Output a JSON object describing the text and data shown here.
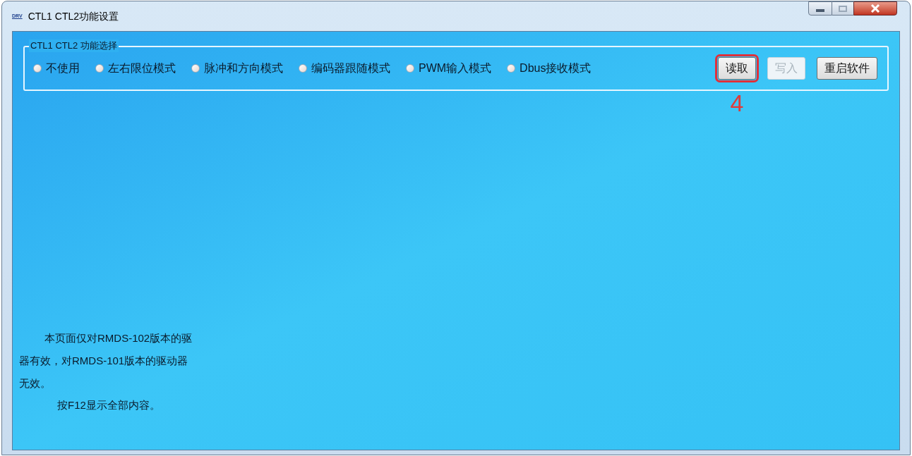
{
  "window": {
    "title": "CTL1 CTL2功能设置",
    "app_icon": "DRV"
  },
  "group": {
    "title": "CTL1 CTL2 功能选择",
    "modes": [
      {
        "label": "不使用",
        "selected": false
      },
      {
        "label": "左右限位模式",
        "selected": false
      },
      {
        "label": "脉冲和方向模式",
        "selected": false
      },
      {
        "label": "编码器跟随模式",
        "selected": false
      },
      {
        "label": "PWM输入模式",
        "selected": false
      },
      {
        "label": "Dbus接收模式",
        "selected": false
      }
    ],
    "buttons": [
      {
        "label": "读取",
        "disabled": false,
        "highlighted": true
      },
      {
        "label": "写入",
        "disabled": true,
        "highlighted": false
      },
      {
        "label": "重启软件",
        "disabled": false,
        "highlighted": false
      }
    ]
  },
  "annotation": "4",
  "notice": {
    "lines": [
      "本页面仅对RMDS-102版本的驱",
      "器有效，对RMDS-101版本的驱动器",
      "无效。"
    ]
  },
  "hint": "按F12显示全部内容。"
}
